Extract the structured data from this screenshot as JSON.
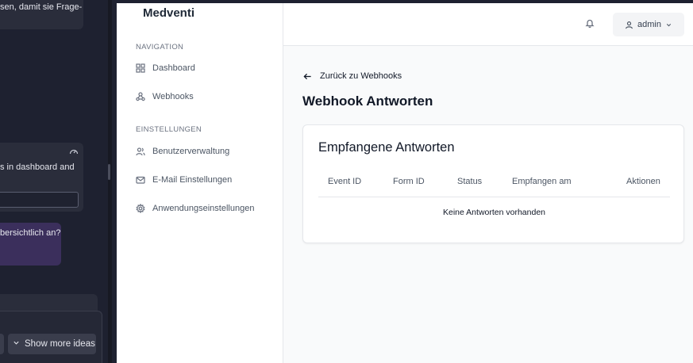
{
  "background_app": {
    "card1_text": "sen, damit sie Frage-",
    "card2_text": "s in dashboard and",
    "card3_text": "bersichtlich an?",
    "show_more_label": "Show more ideas"
  },
  "app": {
    "brand": "Medventi",
    "sidebar": {
      "navigation_heading": "NAVIGATION",
      "navigation_items": [
        {
          "label": "Dashboard",
          "icon": "dashboard-icon"
        },
        {
          "label": "Webhooks",
          "icon": "webhook-icon"
        }
      ],
      "settings_heading": "EINSTELLUNGEN",
      "settings_items": [
        {
          "label": "Benutzerverwaltung",
          "icon": "users-icon"
        },
        {
          "label": "E-Mail Einstellungen",
          "icon": "mail-icon"
        },
        {
          "label": "Anwendungseinstellungen",
          "icon": "gear-icon"
        }
      ]
    },
    "header": {
      "user_label": "admin"
    },
    "main": {
      "back_link": "Zurück zu Webhooks",
      "page_title": "Webhook Antworten",
      "card_title": "Empfangene Antworten",
      "columns": [
        "Event ID",
        "Form ID",
        "Status",
        "Empfangen am",
        "Aktionen"
      ],
      "empty_text": "Keine Antworten vorhanden"
    }
  },
  "colors": {
    "background_dark": "#1e2130",
    "sidebar_bg": "#ffffff",
    "content_bg": "#f9fafb",
    "text_primary": "#111827",
    "text_muted": "#6b7280"
  }
}
